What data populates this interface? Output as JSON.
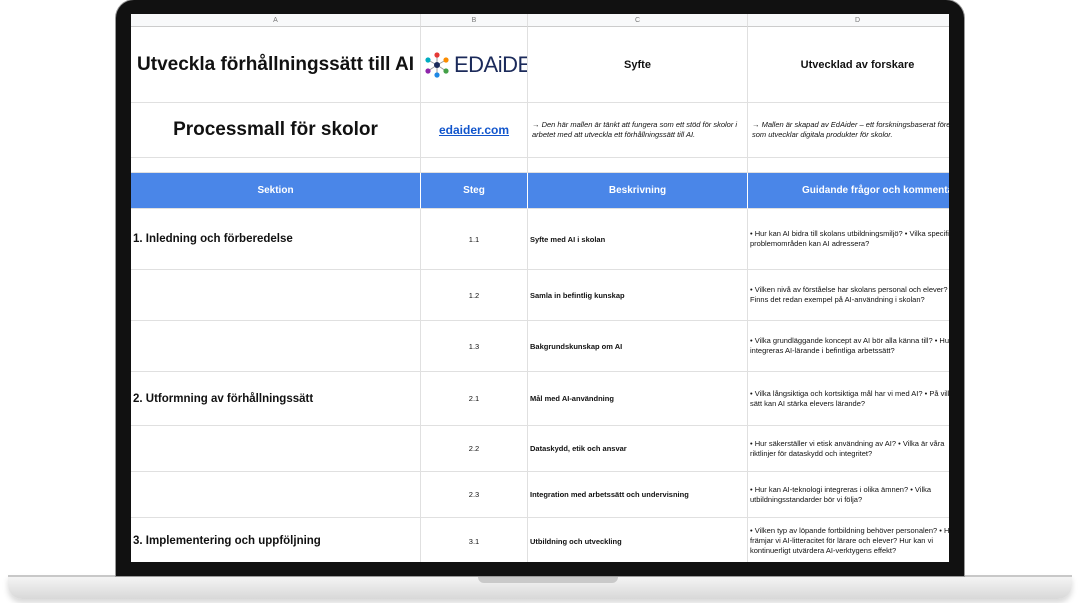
{
  "columns": [
    "A",
    "B",
    "C",
    "D"
  ],
  "title": "Utveckla förhållningssätt till AI",
  "subtitle": "Processmall för skolor",
  "logo": {
    "icon": "molecule-logo-icon",
    "text": "EDAiDER"
  },
  "link": "edaider.com",
  "header_labels": {
    "purpose": "Syfte",
    "developed_by": "Utvecklad av forskare"
  },
  "notes": {
    "purpose": "→  Den här mallen är tänkt att fungera som ett stöd för skolor i arbetet med att utveckla ett förhållningssätt till AI.",
    "developed_by": "→  Mallen är skapad av EdAider – ett forskningsbaserat företag som utvecklar digitala produkter för skolor."
  },
  "table_headers": [
    "Sektion",
    "Steg",
    "Beskrivning",
    "Guidande frågor och kommentarer"
  ],
  "rows": [
    {
      "section": "1. Inledning och förberedelse",
      "step": "1.1",
      "desc": "Syfte med AI i skolan",
      "guide": "• Hur kan AI bidra till skolans utbildningsmiljö? • Vilka specifika problemområden kan AI adressera?"
    },
    {
      "section": "",
      "step": "1.2",
      "desc": "Samla in befintlig kunskap",
      "guide": "• Vilken nivå av förståelse har skolans personal och elever? Finns det redan exempel på AI-användning i skolan?"
    },
    {
      "section": "",
      "step": "1.3",
      "desc": "Bakgrundskunskap om AI",
      "guide": "• Vilka grundläggande koncept av AI bör alla känna till? • Hur integreras AI-lärande i befintliga arbetssätt?"
    },
    {
      "section": "2. Utformning av förhållningssätt",
      "step": "2.1",
      "desc": "Mål med AI-användning",
      "guide": "• Vilka långsiktiga och kortsiktiga mål har vi med AI? • På vilka sätt kan AI stärka elevers lärande?"
    },
    {
      "section": "",
      "step": "2.2",
      "desc": "Dataskydd, etik och ansvar",
      "guide": "• Hur säkerställer vi etisk användning av AI? • Vilka är våra riktlinjer för dataskydd och integritet?"
    },
    {
      "section": "",
      "step": "2.3",
      "desc": "Integration med arbetssätt och undervisning",
      "guide": "• Hur kan AI-teknologi integreras i olika ämnen? • Vilka utbildningsstandarder bör vi följa?"
    },
    {
      "section": "3. Implementering och uppföljning",
      "step": "3.1",
      "desc": "Utbildning och utveckling",
      "guide": "• Vilken typ av löpande fortbildning behöver personalen? • Hur främjar vi AI-litteracitet för lärare och elever? Hur kan vi kontinuerligt utvärdera AI-verktygens effekt?"
    }
  ]
}
